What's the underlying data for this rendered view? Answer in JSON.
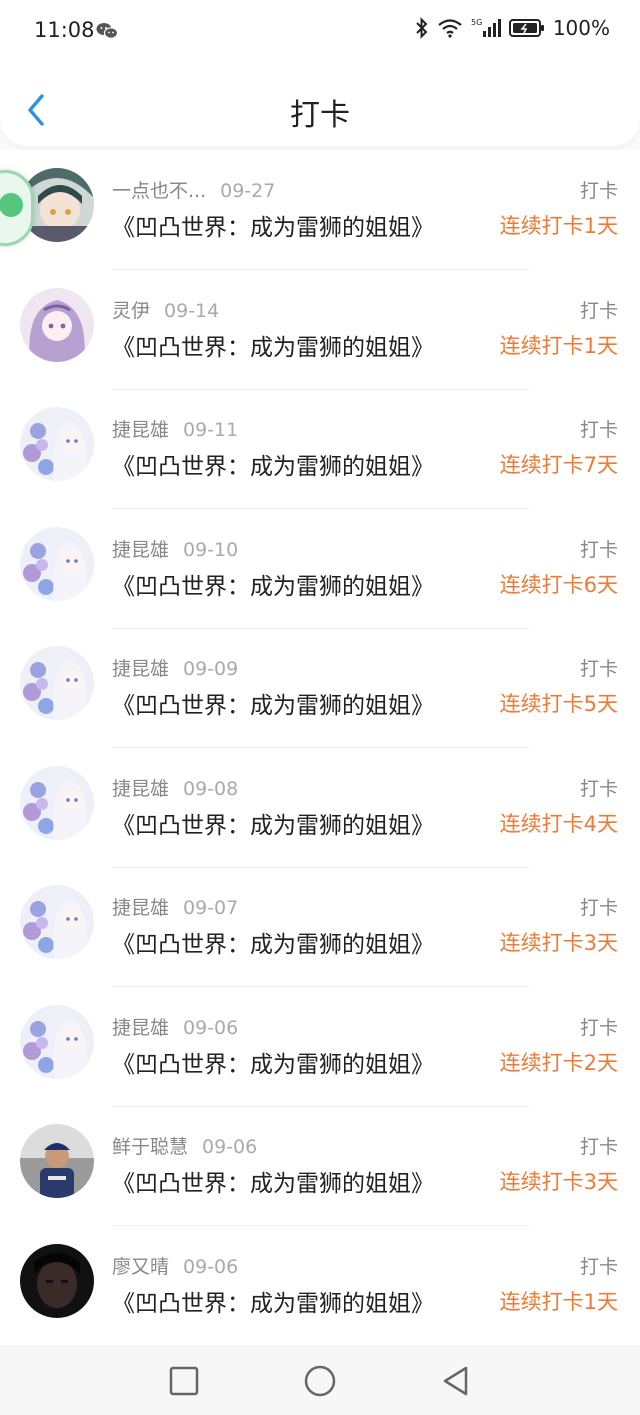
{
  "status_bar": {
    "time": "11:08",
    "battery": "100%",
    "network": "5G",
    "icons": [
      "wechat-icon",
      "bluetooth-icon",
      "wifi-icon",
      "signal-icon",
      "battery-icon"
    ]
  },
  "header": {
    "title": "打卡",
    "back_icon": "chevron-left-icon"
  },
  "colors": {
    "accent_orange": "#f07a35",
    "back_blue": "#2a93e8",
    "text_primary": "#222222",
    "text_secondary": "#888888"
  },
  "list": {
    "items": [
      {
        "name": "一点也不...",
        "date": "09-27",
        "book": "《凹凸世界：成为雷狮的姐姐》",
        "type": "打卡",
        "streak": "连续打卡1天",
        "avatar": "anime-boy-avatar"
      },
      {
        "name": "灵伊",
        "date": "09-14",
        "book": "《凹凸世界：成为雷狮的姐姐》",
        "type": "打卡",
        "streak": "连续打卡1天",
        "avatar": "anime-girl-purple-avatar"
      },
      {
        "name": "捷昆雄",
        "date": "09-11",
        "book": "《凹凸世界：成为雷狮的姐姐》",
        "type": "打卡",
        "streak": "连续打卡7天",
        "avatar": "anime-girl-flowers-avatar"
      },
      {
        "name": "捷昆雄",
        "date": "09-10",
        "book": "《凹凸世界：成为雷狮的姐姐》",
        "type": "打卡",
        "streak": "连续打卡6天",
        "avatar": "anime-girl-flowers-avatar"
      },
      {
        "name": "捷昆雄",
        "date": "09-09",
        "book": "《凹凸世界：成为雷狮的姐姐》",
        "type": "打卡",
        "streak": "连续打卡5天",
        "avatar": "anime-girl-flowers-avatar"
      },
      {
        "name": "捷昆雄",
        "date": "09-08",
        "book": "《凹凸世界：成为雷狮的姐姐》",
        "type": "打卡",
        "streak": "连续打卡4天",
        "avatar": "anime-girl-flowers-avatar"
      },
      {
        "name": "捷昆雄",
        "date": "09-07",
        "book": "《凹凸世界：成为雷狮的姐姐》",
        "type": "打卡",
        "streak": "连续打卡3天",
        "avatar": "anime-girl-flowers-avatar"
      },
      {
        "name": "捷昆雄",
        "date": "09-06",
        "book": "《凹凸世界：成为雷狮的姐姐》",
        "type": "打卡",
        "streak": "连续打卡2天",
        "avatar": "anime-girl-flowers-avatar"
      },
      {
        "name": "鲜于聪慧",
        "date": "09-06",
        "book": "《凹凸世界：成为雷狮的姐姐》",
        "type": "打卡",
        "streak": "连续打卡3天",
        "avatar": "photo-man-cap-avatar"
      },
      {
        "name": "廖又晴",
        "date": "09-06",
        "book": "《凹凸世界：成为雷狮的姐姐》",
        "type": "打卡",
        "streak": "连续打卡1天",
        "avatar": "photo-dark-avatar"
      }
    ]
  },
  "nav_bar": {
    "buttons": [
      "recents-square-icon",
      "home-circle-icon",
      "back-triangle-icon"
    ]
  }
}
